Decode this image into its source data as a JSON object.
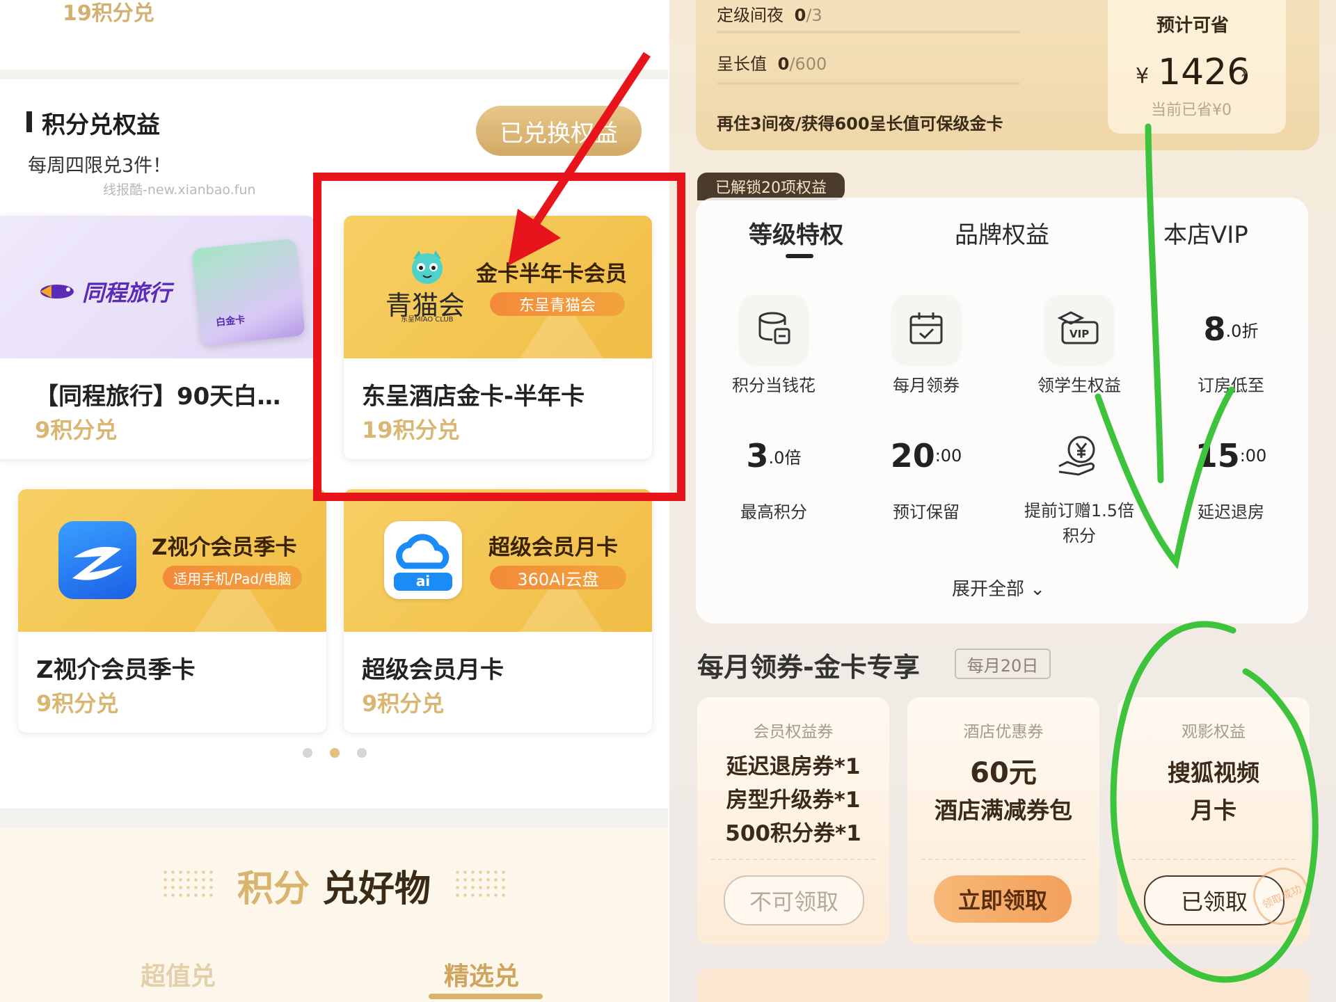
{
  "left": {
    "top_price": "19积分兑",
    "section": {
      "title": "积分兑权益",
      "subtitle": "每周四限兑3件！",
      "watermark": "线报酷-new.xianbao.fun",
      "redeemed_button": "已兑换权益"
    },
    "cards": [
      {
        "name": "【同程旅行】90天白…",
        "price": "9积分兑",
        "brand": "同程旅行",
        "card_label": "白金卡"
      },
      {
        "name": "东呈酒店金卡-半年卡",
        "price": "19积分兑",
        "brand": "青猫会",
        "brand_sub": "东呈MIAO CLUB",
        "headline": "金卡半年卡会员",
        "tag": "东呈青猫会"
      },
      {
        "name": "Z视介会员季卡",
        "price": "9积分兑",
        "headline": "Z视介会员季卡",
        "tag": "适用手机/Pad/电脑"
      },
      {
        "name": "超级会员月卡",
        "price": "9积分兑",
        "headline": "超级会员月卡",
        "tag": "360AI云盘",
        "icon_text": "ai"
      }
    ],
    "pager": {
      "count": 3,
      "active": 1
    },
    "goods": {
      "title_a": "积分",
      "title_b": "兑好物",
      "tabs": [
        {
          "label": "超值兑",
          "active": false
        },
        {
          "label": "精选兑",
          "active": true
        }
      ]
    }
  },
  "right": {
    "level": {
      "nights_label": "定级间夜",
      "nights_value": "0",
      "nights_total": "/3",
      "growth_label": "呈长值",
      "growth_value": "0",
      "growth_total": "/600",
      "hint": "再住3间夜/获得600呈长值可保级金卡"
    },
    "savings": {
      "title": "预计可省",
      "currency": "¥",
      "amount": "1426",
      "current": "当前已省¥0"
    },
    "unlock_badge": "已解锁20项权益",
    "tabs": [
      {
        "label": "等级特权",
        "active": true
      },
      {
        "label": "品牌权益",
        "active": false
      },
      {
        "label": "本店VIP",
        "active": false
      }
    ],
    "privileges": [
      {
        "label": "积分当钱花",
        "icon": "coins-icon"
      },
      {
        "label": "每月领券",
        "icon": "calendar-icon"
      },
      {
        "label": "领学生权益",
        "icon": "vip-student-icon",
        "icon_text": "VIP"
      },
      {
        "label": "订房低至",
        "num": "8",
        "unit": ".0折"
      },
      {
        "label": "最高积分",
        "num": "3",
        "unit": ".0倍"
      },
      {
        "label": "预订保留",
        "num": "20",
        "unit": ":00"
      },
      {
        "label": "提前订赠1.5倍\n积分",
        "icon": "yen-hand-icon"
      },
      {
        "label": "延迟退房",
        "num": "15",
        "unit": ":00"
      }
    ],
    "expand_all": "展开全部",
    "coupons": {
      "title": "每月领券-金卡专享",
      "date_tag": "每月20日",
      "items": [
        {
          "type": "会员权益券",
          "lines": [
            "延迟退房券*1",
            "房型升级券*1",
            "500积分券*1"
          ],
          "button": "不可领取",
          "state": "disabled"
        },
        {
          "type": "酒店优惠券",
          "lines": [
            "60元",
            "酒店满减券包"
          ],
          "button": "立即领取",
          "state": "available"
        },
        {
          "type": "观影权益",
          "lines": [
            "搜狐视频",
            "月卡"
          ],
          "button": "已领取",
          "state": "claimed",
          "stamp": "领取成功"
        }
      ]
    }
  }
}
